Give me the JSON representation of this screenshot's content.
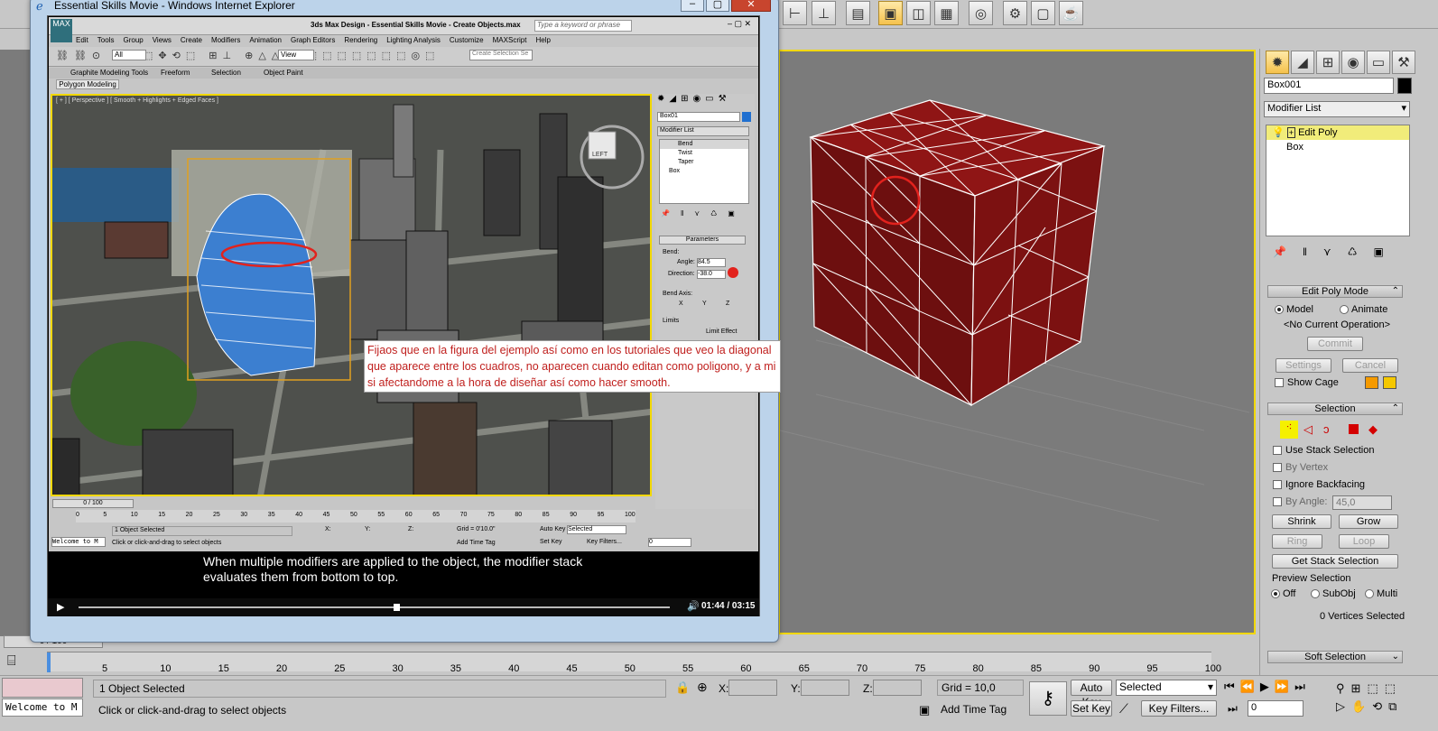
{
  "ie_window": {
    "title": "Essential Skills Movie - Windows Internet Explorer",
    "inner_title": "3ds Max Design - Essential Skills Movie - Create Objects.max",
    "search_placeholder": "Type a keyword or phrase",
    "menu": [
      "Edit",
      "Tools",
      "Group",
      "Views",
      "Create",
      "Modifiers",
      "Animation",
      "Graph Editors",
      "Rendering",
      "Lighting Analysis",
      "Customize",
      "MAXScript",
      "Help"
    ],
    "ribbon_tabs": [
      "Graphite Modeling Tools",
      "Freeform",
      "Selection",
      "Object Paint"
    ],
    "ribbon_sub": "Polygon Modeling",
    "viewport_label": "[ + ] [ Perspective ] [ Smooth + Highlights + Edged Faces ]",
    "view_dropdown": "View",
    "filter_dropdown": "All",
    "named_sel": "Create Selection Se",
    "cube_label": "LEFT",
    "object_name": "Box01",
    "modifier_list": "Modifier List",
    "stack": [
      "Bend",
      "Twist",
      "Taper",
      "Box"
    ],
    "params_title": "Parameters",
    "bend_label": "Bend:",
    "angle_label": "Angle:",
    "angle_value": "84.5",
    "direction_label": "Direction:",
    "direction_value": "-38.0",
    "bend_axis_label": "Bend Axis:",
    "axis_x": "X",
    "axis_y": "Y",
    "axis_z": "Z",
    "limits_label": "Limits",
    "limit_effect": "Limit Effect",
    "slider_text": "0 / 100",
    "ticks": [
      "0",
      "5",
      "10",
      "15",
      "20",
      "25",
      "30",
      "35",
      "40",
      "45",
      "50",
      "55",
      "60",
      "65",
      "70",
      "75",
      "80",
      "85",
      "90",
      "95",
      "100"
    ],
    "status_selected": "1 Object Selected",
    "status_prompt": "Click or click-and-drag to select objects",
    "welcome": "Welcome to M",
    "x_label": "X:",
    "y_label": "Y:",
    "z_label": "Z:",
    "grid": "Grid = 0'10.0\"",
    "auto_key": "Auto Key",
    "set_key": "Set Key",
    "selected": "Selected",
    "key_filters": "Key Filters...",
    "add_time_tag": "Add Time Tag",
    "frame": "0",
    "caption_line1": "When multiple modifiers are applied to the object, the modifier stack",
    "caption_line2": "evaluates them from bottom to top.",
    "time": "01:44 / 03:15"
  },
  "note_text": "Fijaos que en la figura del ejemplo así como en los tutoriales que veo  la diagonal que aparece entre los cuadros, no aparecen cuando editan como poligono, y a mi si afectandome a la hora de diseñar así como hacer smooth.",
  "panel": {
    "object_name": "Box001",
    "modifier_list": "Modifier List",
    "stack_top": "Edit Poly",
    "stack_base": "Box",
    "edit_poly_mode": "Edit Poly Mode",
    "model": "Model",
    "animate": "Animate",
    "no_op": "<No Current Operation>",
    "commit": "Commit",
    "settings": "Settings",
    "cancel": "Cancel",
    "show_cage": "Show Cage",
    "selection": "Selection",
    "use_stack": "Use Stack Selection",
    "by_vertex": "By Vertex",
    "ignore_backfacing": "Ignore Backfacing",
    "by_angle": "By Angle:",
    "by_angle_value": "45,0",
    "shrink": "Shrink",
    "grow": "Grow",
    "ring": "Ring",
    "loop": "Loop",
    "get_stack": "Get Stack Selection",
    "preview_sel": "Preview Selection",
    "off": "Off",
    "subobj": "SubObj",
    "multi": "Multi",
    "vertices_selected": "0 Vertices Selected",
    "soft_selection": "Soft Selection"
  },
  "main": {
    "ticks": [
      "5",
      "10",
      "15",
      "20",
      "25",
      "30",
      "35",
      "40",
      "45",
      "50",
      "55",
      "60",
      "65",
      "70",
      "75",
      "80",
      "85",
      "90",
      "95",
      "100"
    ],
    "slider_text": "0 / 100",
    "status_selected": "1 Object Selected",
    "status_prompt": "Click or click-and-drag to select objects",
    "welcome": "Welcome to M",
    "x_label": "X:",
    "y_label": "Y:",
    "z_label": "Z:",
    "grid": "Grid = 10,0",
    "auto_key": "Auto Key",
    "set_key": "Set Key",
    "selected": "Selected",
    "key_filters": "Key Filters...",
    "add_time_tag": "Add Time Tag",
    "frame": "0"
  },
  "colors": {
    "accent_yellow": "#f2d800",
    "box_red": "#7a0f0f",
    "note_text": "#c0201e"
  }
}
